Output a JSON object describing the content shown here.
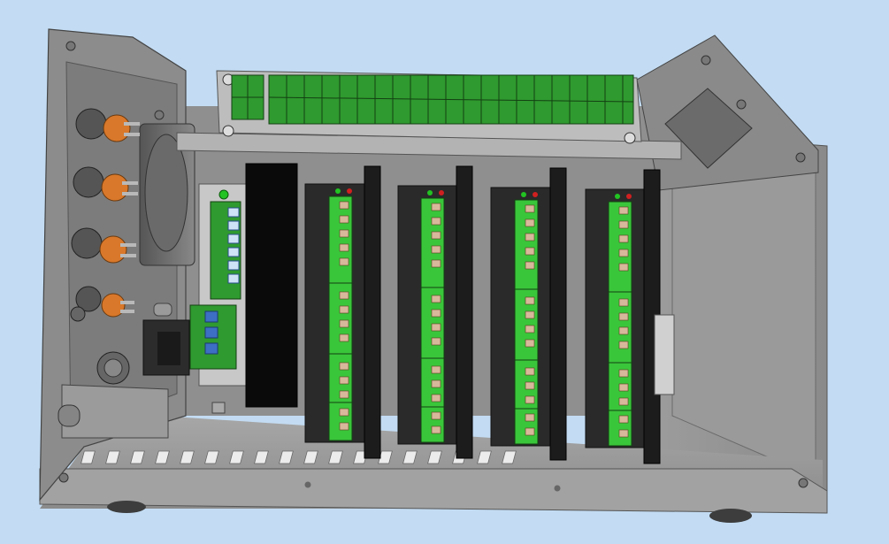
{
  "scene": {
    "background": "#c3dcf3",
    "enclosure_color": "#9a9a9a",
    "enclosure_dark": "#6e6e6e",
    "enclosure_light": "#b9b9b9",
    "terminal_green": "#2f9a2f",
    "terminal_green_light": "#4fd04f",
    "driver_body": "#2a2a2a",
    "heatsink": "#0a0a0a",
    "led_green": "#22c322",
    "led_red": "#d02020",
    "connector_orange": "#d9782a",
    "drivers": 4,
    "front_connectors": 5
  }
}
